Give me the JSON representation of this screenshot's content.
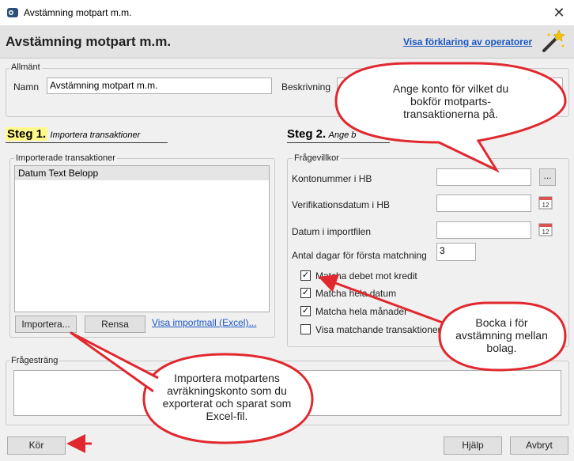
{
  "window": {
    "title": "Avstämning motpart m.m.",
    "close_glyph": "✕"
  },
  "header": {
    "title": "Avstämning motpart m.m.",
    "link": "Visa förklaring av operatorer"
  },
  "general": {
    "group_label": "Allmänt",
    "name_label": "Namn",
    "name_value": "Avstämning motpart m.m.",
    "description_label": "Beskrivning",
    "description_value": ""
  },
  "step1": {
    "number": "Steg 1.",
    "description": "Importera transaktioner",
    "group_label": "Importerade transaktioner",
    "list_items": [
      "Datum Text Belopp"
    ],
    "import_button": "Importera...",
    "clear_button": "Rensa",
    "template_link": "Visa importmall (Excel)..."
  },
  "step2": {
    "number": "Steg 2.",
    "description": "Ange b",
    "group_label": "Frågevillkor",
    "account_label": "Kontonummer i HB",
    "account_value": "",
    "browse_button": "...",
    "verdate_label": "Verifikationsdatum i HB",
    "verdate_value": "",
    "importdate_label": "Datum i importfilen",
    "importdate_value": "",
    "days_label": "Antal dagar för första matchning",
    "days_value": "3",
    "calendar_day": "12",
    "checkboxes": [
      {
        "label": "Matcha debet mot kredit",
        "checked": true
      },
      {
        "label": "Matcha hela datum",
        "checked": true
      },
      {
        "label": "Matcha hela månader",
        "checked": true
      },
      {
        "label": "Visa matchande transaktioner",
        "checked": false
      }
    ]
  },
  "query": {
    "group_label": "Frågesträng",
    "value": ""
  },
  "footer": {
    "run_button": "Kör",
    "help_button": "Hjälp",
    "cancel_button": "Avbryt"
  },
  "callouts": {
    "account_hint": "Ange konto för vilket du bokför motparts-transaktionerna på.",
    "match_hint": "Bocka i för avstämning mellan bolag.",
    "import_hint": "Importera motpartens avräkningskonto som du exporterat och sparat som Excel-fil."
  },
  "colors": {
    "annotation_red": "#e0282e",
    "link_blue": "#1a56c4",
    "step_highlight": "#fff98a"
  }
}
